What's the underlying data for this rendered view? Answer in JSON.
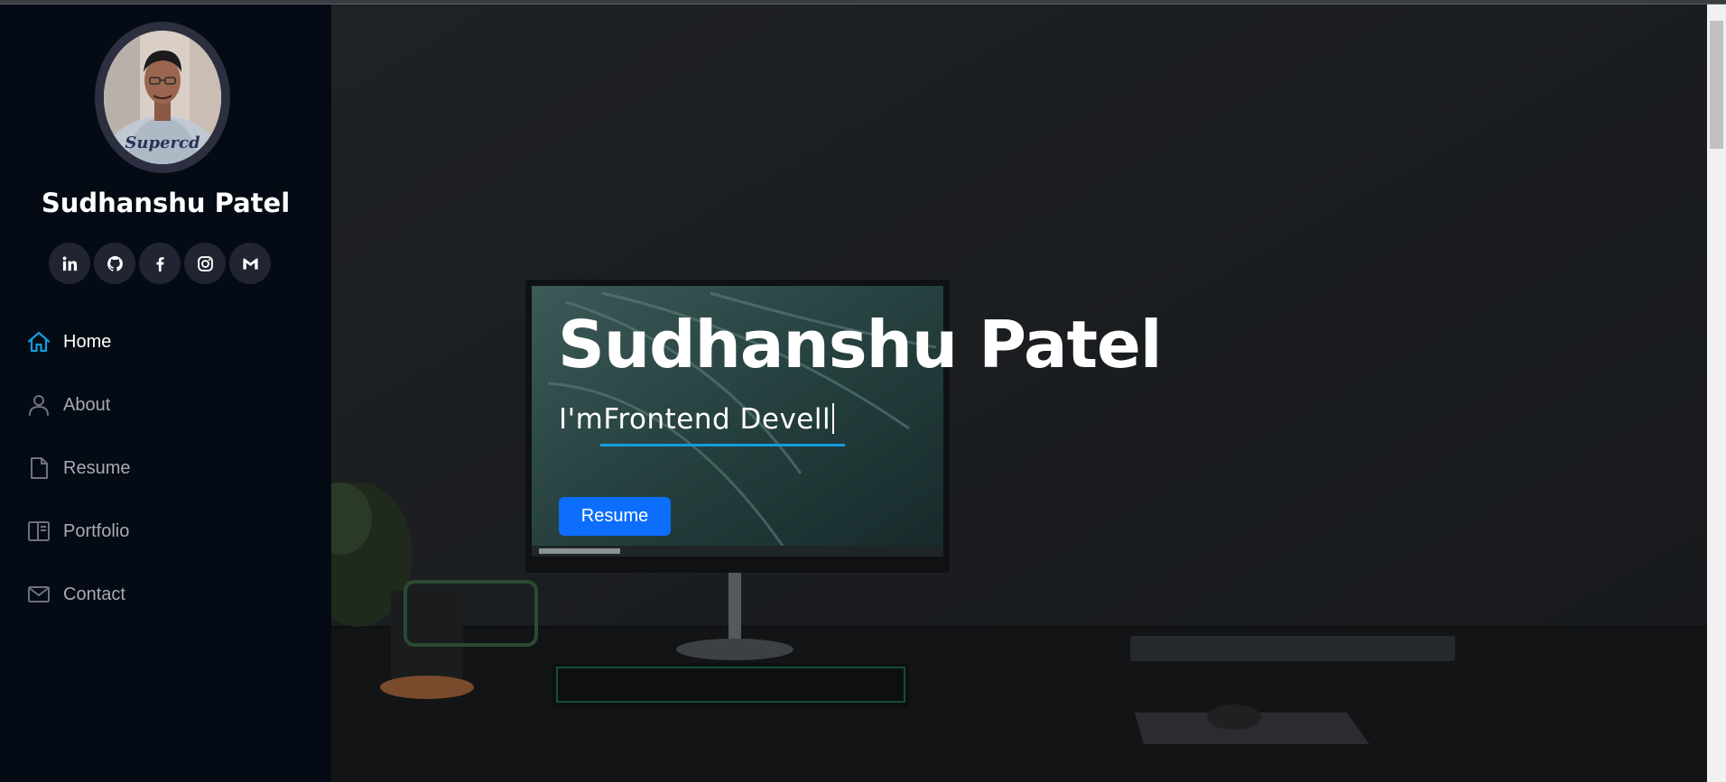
{
  "profile": {
    "name": "Sudhanshu Patel",
    "avatar_alt": "profile-photo"
  },
  "socials": [
    {
      "icon": "linkedin-icon"
    },
    {
      "icon": "github-icon"
    },
    {
      "icon": "facebook-icon"
    },
    {
      "icon": "instagram-icon"
    },
    {
      "icon": "gmail-icon"
    }
  ],
  "nav": {
    "items": [
      {
        "label": "Home",
        "icon": "home-icon",
        "active": true
      },
      {
        "label": "About",
        "icon": "person-icon",
        "active": false
      },
      {
        "label": "Resume",
        "icon": "file-icon",
        "active": false
      },
      {
        "label": "Portfolio",
        "icon": "portfolio-icon",
        "active": false
      },
      {
        "label": "Contact",
        "icon": "envelope-icon",
        "active": false
      }
    ]
  },
  "hero": {
    "name": "Sudhanshu Patel",
    "typed_text": "I'mFrontend Devell",
    "button_label": "Resume"
  },
  "colors": {
    "sidebar_bg": "#040b14",
    "accent": "#149ddd",
    "button": "#0d6efd"
  }
}
